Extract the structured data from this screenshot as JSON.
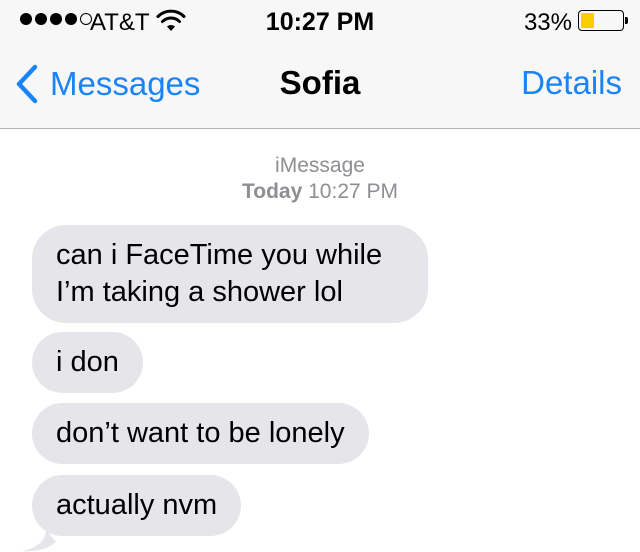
{
  "status_bar": {
    "carrier": "AT&T",
    "time": "10:27 PM",
    "battery_percent": "33%",
    "battery_level": 0.33,
    "signal_bars_filled": 4,
    "signal_bars_total": 5,
    "icons": [
      "wifi-icon",
      "battery-icon"
    ]
  },
  "nav": {
    "back_label": "Messages",
    "title": "Sofia",
    "details_label": "Details",
    "accent_color": "#1a84f7"
  },
  "thread": {
    "service": "iMessage",
    "day": "Today",
    "time": "10:27 PM",
    "bubble_color": "#e5e5ea",
    "messages": [
      {
        "text": "can i FaceTime you while I’m taking a shower lol"
      },
      {
        "text": "i don"
      },
      {
        "text": "don’t want to be lonely"
      },
      {
        "text": "actually nvm"
      }
    ]
  }
}
